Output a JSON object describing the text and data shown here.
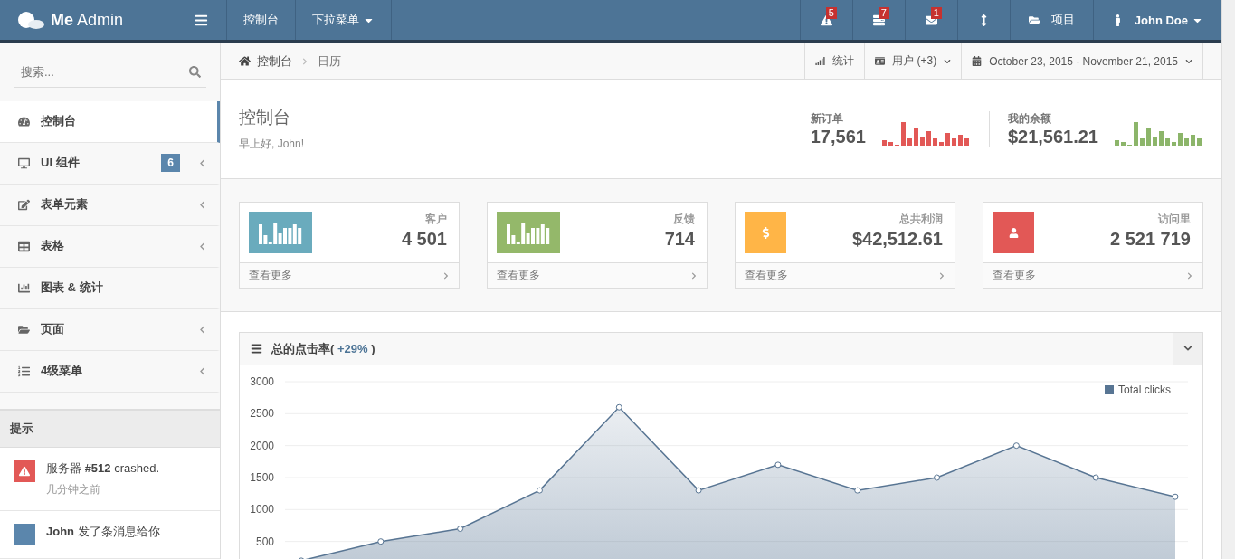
{
  "brand": {
    "bold": "Me",
    "rest": "Admin"
  },
  "top_nav": [
    {
      "label": "控制台",
      "dropdown": false
    },
    {
      "label": "下拉菜单",
      "dropdown": true
    }
  ],
  "top_right": [
    {
      "kind": "alert",
      "badge": "5"
    },
    {
      "kind": "tasks",
      "badge": "7"
    },
    {
      "kind": "mail",
      "badge": "1"
    },
    {
      "kind": "resize"
    },
    {
      "kind": "folder",
      "label": "项目"
    },
    {
      "kind": "user",
      "label": "John Doe",
      "dropdown": true
    }
  ],
  "search": {
    "placeholder": "搜索..."
  },
  "sidebar": {
    "items": [
      {
        "kind": "dashboard",
        "label": "控制台",
        "selected": true,
        "expandable": false
      },
      {
        "kind": "desktop",
        "label": "UI 组件",
        "badge": "6",
        "selected": false,
        "expandable": true
      },
      {
        "kind": "edit",
        "label": "表单元素",
        "selected": false,
        "expandable": true
      },
      {
        "kind": "table",
        "label": "表格",
        "selected": false,
        "expandable": true
      },
      {
        "kind": "chart",
        "label": "图表 & 统计",
        "selected": false,
        "expandable": false
      },
      {
        "kind": "folder",
        "label": "页面",
        "selected": false,
        "expandable": true
      },
      {
        "kind": "list",
        "label": "4级菜单",
        "selected": false,
        "expandable": true
      }
    ],
    "tips_title": "提示",
    "tips": [
      {
        "kind": "alert",
        "text": "服务器 **#512** crashed.",
        "time": "几分钟之前"
      },
      {
        "kind": "avatar",
        "text": "**John** 发了条消息给你"
      }
    ]
  },
  "breadcrumb": [
    {
      "label": "控制台",
      "home": true
    },
    {
      "label": "日历",
      "home": false
    }
  ],
  "toolbar": [
    {
      "kind": "stats",
      "label": "统计"
    },
    {
      "kind": "users",
      "label": "用户 (+3)",
      "dropdown": true
    },
    {
      "kind": "calendar",
      "label": "October 23, 2015 - November 21, 2015",
      "dropdown": true
    }
  ],
  "page": {
    "title": "控制台",
    "subtitle": "早上好, John!"
  },
  "header_stats": [
    {
      "label": "新订单",
      "value": "17,561",
      "color": "#e25856"
    },
    {
      "label": "我的余额",
      "value": "$21,561.21",
      "color": "#8cb56a"
    }
  ],
  "stat_cards": [
    {
      "kind": "bars",
      "label": "客户",
      "value": "4 501",
      "link": "查看更多",
      "color": "#6aabbd"
    },
    {
      "kind": "bars",
      "label": "反馈",
      "value": "714",
      "link": "查看更多",
      "color": "#94b86a"
    },
    {
      "kind": "dollar",
      "label": "总共利润",
      "value": "$42,512.61",
      "link": "查看更多",
      "color": "#ffb547"
    },
    {
      "kind": "user",
      "label": "访问里",
      "value": "2 521 719",
      "link": "查看更多",
      "color": "#e25856"
    }
  ],
  "chart_panel": {
    "title": "总的点击率(",
    "highlight": "+29%",
    "title_end": ")",
    "chart_data": {
      "type": "area",
      "grid": true,
      "ylim": [
        0,
        3000
      ],
      "yticks": [
        500,
        1000,
        1500,
        2000,
        2500,
        3000
      ],
      "series": [
        {
          "name": "Total clicks",
          "color": "#587593",
          "values": [
            200,
            500,
            700,
            1300,
            2600,
            1300,
            1700,
            1300,
            1500,
            2000,
            1500,
            1200
          ]
        }
      ]
    }
  }
}
